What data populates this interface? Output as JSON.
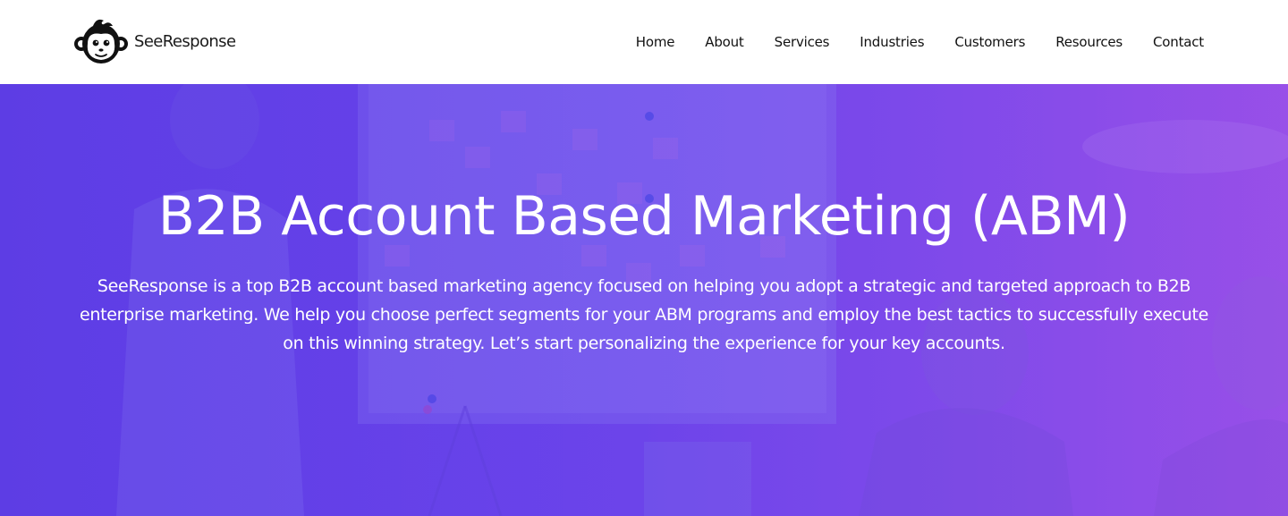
{
  "header": {
    "logo_text": "SeeResponse",
    "logo_icon": "monkey-head-icon",
    "nav": [
      {
        "label": "Home"
      },
      {
        "label": "About"
      },
      {
        "label": "Services"
      },
      {
        "label": "Industries"
      },
      {
        "label": "Customers"
      },
      {
        "label": "Resources"
      },
      {
        "label": "Contact"
      }
    ]
  },
  "hero": {
    "title": "B2B Account Based Marketing (ABM)",
    "description": "SeeResponse is a top B2B account based marketing agency focused on helping you adopt a strategic and targeted approach to B2B enterprise marketing. We help you choose perfect segments for your ABM programs and employ the best tactics to successfully execute on this winning strategy. Let’s start personalizing the experience for your key accounts."
  },
  "colors": {
    "hero_gradient_start": "#5e3ee0",
    "hero_gradient_end": "#9a4fe6",
    "header_bg": "#ffffff",
    "nav_text": "#111111"
  }
}
